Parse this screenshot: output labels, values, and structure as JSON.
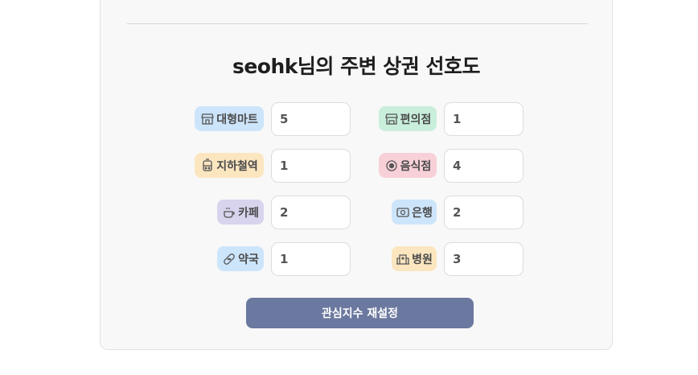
{
  "title": "seohk님의 주변 상권 선호도",
  "categories": [
    {
      "label": "대형마트",
      "value": "5",
      "icon": "store-icon",
      "color": "#cde5fb"
    },
    {
      "label": "편의점",
      "value": "1",
      "icon": "convenience-store-icon",
      "color": "#c9eedc"
    },
    {
      "label": "지하철역",
      "value": "1",
      "icon": "subway-icon",
      "color": "#fbe6c0"
    },
    {
      "label": "음식점",
      "value": "4",
      "icon": "restaurant-icon",
      "color": "#f8d0d8"
    },
    {
      "label": "카페",
      "value": "2",
      "icon": "coffee-icon",
      "color": "#d8d4ee"
    },
    {
      "label": "은행",
      "value": "2",
      "icon": "bank-icon",
      "color": "#cde5fb"
    },
    {
      "label": "약국",
      "value": "1",
      "icon": "bandage-icon",
      "color": "#cde5fb"
    },
    {
      "label": "병원",
      "value": "3",
      "icon": "hospital-icon",
      "color": "#fbe6c0"
    }
  ],
  "reset_button_label": "관심지수 재설정",
  "colors": {
    "button": "#6b789f",
    "card_background": "#f8f8f8"
  }
}
